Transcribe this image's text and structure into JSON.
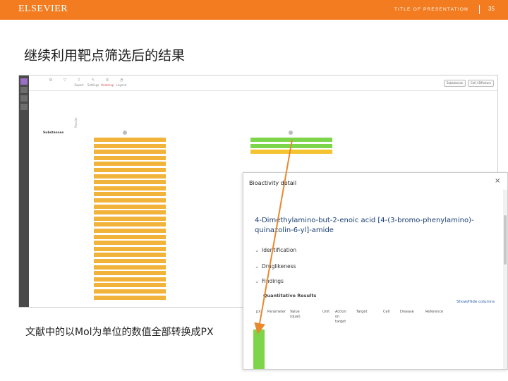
{
  "slide": {
    "brand": "ELSEVIER",
    "presentation_title": "TITLE OF PRESENTATION",
    "page_number": "35",
    "heading": "继续利用靶点筛选后的结果",
    "caption": "文献中的以Mol为单位的数值全部转换成PX",
    "colors": {
      "header_bar": "#f47c20",
      "highlight_green": "#7dd54a",
      "highlight_orange": "#f2b33a",
      "arrow": "#e8892e"
    }
  },
  "reaxys": {
    "side_tabs": [
      "",
      "",
      "",
      ""
    ],
    "toolbar": [
      {
        "label": "",
        "icon": "gear-icon"
      },
      {
        "label": "",
        "icon": "filter-icon"
      },
      {
        "label": "Export",
        "icon": "export-icon"
      },
      {
        "label": "Settings",
        "icon": "settings-icon"
      },
      {
        "label": "Heatmap",
        "icon": "heatmap-icon"
      },
      {
        "label": "Legend",
        "icon": "legend-icon"
      }
    ],
    "right_buttons": [
      "Substances",
      "Cell / Effectors"
    ],
    "column_heads": [
      "",
      "",
      "",
      "",
      ""
    ],
    "substances_label": "Substances",
    "results_label": "Results",
    "rows": [
      {
        "label": "",
        "c1": "",
        "c2": ""
      },
      {
        "label": "",
        "c1": "",
        "c2": ""
      },
      {
        "label": "",
        "c1": "",
        "c2": ""
      }
    ]
  },
  "popup": {
    "title": "Bioactivity detail",
    "close_glyph": "×",
    "crumb1": "",
    "crumb2": "",
    "compound_name": "4-Dimethylamino-but-2-enoic acid [4-(3-bromo-phenylamino)-quinazolin-6-yl]-amide",
    "sections": [
      {
        "chev": "⌄",
        "label": "Identification"
      },
      {
        "chev": "⌄",
        "label": "Druglikeness"
      },
      {
        "chev": "⌄",
        "label": "Findings"
      }
    ],
    "subheading": "Quantitative Results",
    "show_hide": "Show/Hide columns",
    "table_headers": [
      "pX",
      "Parameter",
      "Value (qual)",
      "Unit",
      "Action on target",
      "Target",
      "Cell",
      "Disease",
      "Reference"
    ],
    "row": {
      "px": "",
      "parameter": "",
      "value": "",
      "unit": "",
      "target": "",
      "cell": "",
      "disease": "",
      "reference": ""
    },
    "footer_links": [
      "",
      ""
    ]
  }
}
